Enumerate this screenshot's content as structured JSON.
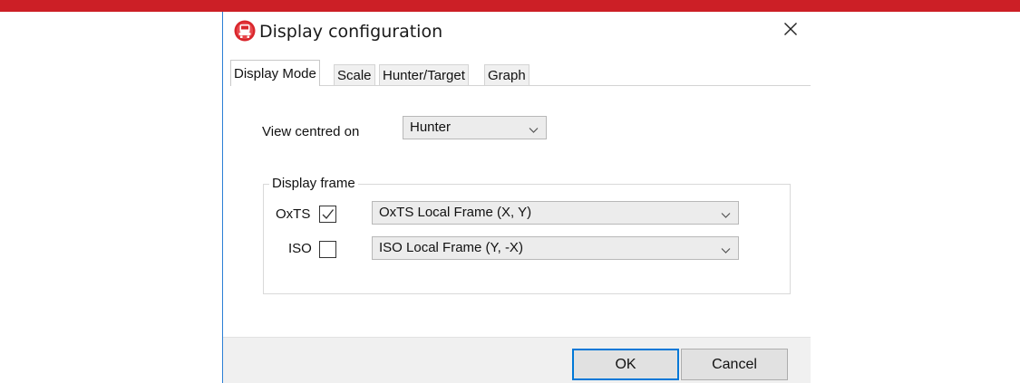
{
  "colors": {
    "accent_bar": "#cc1f26",
    "default_button_border": "#0078d7",
    "window_border": "#2b7fd6"
  },
  "window": {
    "title": "Display configuration",
    "icon": "app-logo-icon",
    "close_icon": "close-icon"
  },
  "tabs": [
    {
      "label": "Display Mode",
      "active": true
    },
    {
      "label": "Scale",
      "active": false
    },
    {
      "label": "Hunter/Target",
      "active": false
    },
    {
      "label": "Graph",
      "active": false
    }
  ],
  "display_mode": {
    "view_centred_label": "View centred on",
    "view_centred_value": "Hunter",
    "display_frame": {
      "legend": "Display frame",
      "oxts": {
        "label": "OxTS",
        "checked": true,
        "frame_value": "OxTS Local Frame (X, Y)"
      },
      "iso": {
        "label": "ISO",
        "checked": false,
        "frame_value": "ISO Local Frame (Y, -X)"
      }
    }
  },
  "buttons": {
    "ok": "OK",
    "cancel": "Cancel"
  }
}
